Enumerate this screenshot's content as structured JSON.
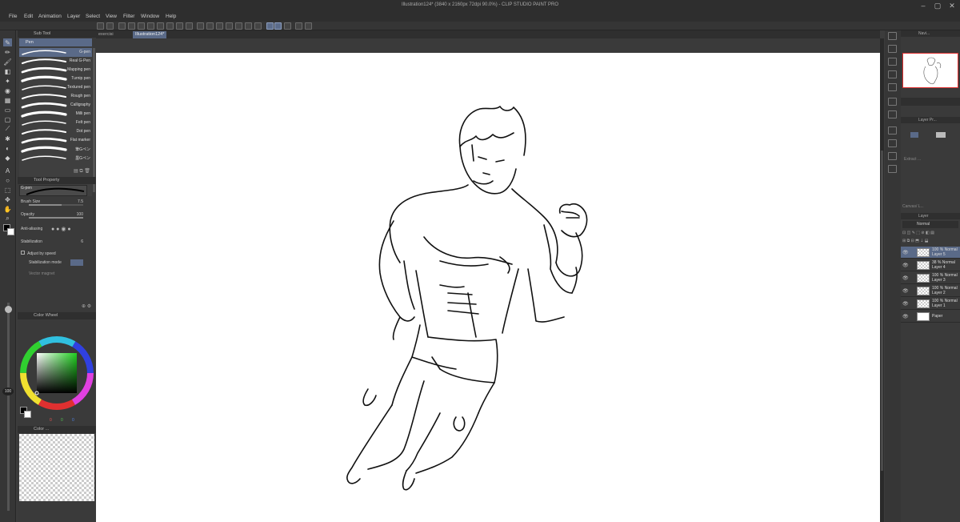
{
  "window": {
    "title": "Illustration124* (3840 x 2160px 72dpi 90.0%)  -  CLIP STUDIO PAINT PRO"
  },
  "menu": [
    "File",
    "Edit",
    "Animation",
    "Layer",
    "Select",
    "View",
    "Filter",
    "Window",
    "Help"
  ],
  "tabs": [
    {
      "label": "exercisi"
    },
    {
      "label": "Illustration124*"
    }
  ],
  "subtool": {
    "header": "Sub Tool",
    "group": "Pen",
    "brushes": [
      "G-pen",
      "Real G-Pen",
      "Mapping pen",
      "Turnip pen",
      "Textured pen",
      "Rough pen",
      "Calligraphy",
      "Milli pen",
      "Felt pen",
      "Dot pen",
      "Flat marker",
      "筆Gペン",
      "墨Gペン"
    ]
  },
  "tool_property": {
    "header": "Tool Property",
    "preview_label": "G-pen",
    "brush_size_label": "Brush Size",
    "brush_size_value": "7.5",
    "opacity_label": "Opacity",
    "opacity_value": "100",
    "anti_aliasing_label": "Anti-aliasing",
    "stabilization_label": "Stabilization",
    "stabilization_value": "6",
    "adjust_by_speed_label": "Adjust by speed",
    "stabilization_mode_label": "Stabilization mode",
    "vector_magnet_label": "Vector magnet"
  },
  "color": {
    "panel_label": "Color Wheel",
    "size_readout": "100",
    "rgb_values": [
      "0",
      "0",
      "0"
    ],
    "main_color": "#000000",
    "sub_color": "#ffffff",
    "palette": [
      "#e03030",
      "#f08030",
      "#f0e040",
      "#40c040",
      "#3090e0",
      "#6040c0",
      "#ffffff"
    ]
  },
  "color_set_label": "Color ...",
  "navigator": {
    "label": "Navi..."
  },
  "layer_property_label": "Layer Pr...",
  "extract_label": "Extract ...",
  "lighttable_label": "Canvas/ L...",
  "layers": {
    "tab_label": "Layer",
    "blend_mode_label": "Normal",
    "opacity_value": "100",
    "items": [
      {
        "opacity": "100 %",
        "blend": "Normal",
        "name": "Layer 5"
      },
      {
        "opacity": "38 %",
        "blend": "Normal",
        "name": "Layer 4"
      },
      {
        "opacity": "100 %",
        "blend": "Normal",
        "name": "Layer 3"
      },
      {
        "opacity": "100 %",
        "blend": "Normal",
        "name": "Layer 2"
      },
      {
        "opacity": "100 %",
        "blend": "Normal",
        "name": "Layer 1"
      },
      {
        "opacity": "",
        "blend": "",
        "name": "Paper"
      }
    ]
  },
  "colors": {
    "accent": "#5a6a88",
    "panel": "#3a3a3a",
    "canvas": "#ffffff"
  }
}
